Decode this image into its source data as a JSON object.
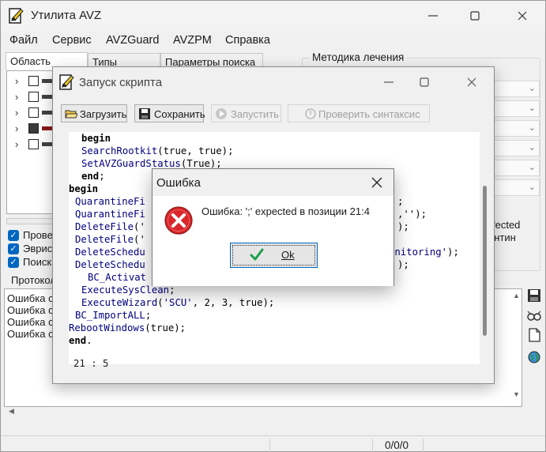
{
  "main": {
    "title": "Утилита AVZ",
    "menu": [
      "Файл",
      "Сервис",
      "AVZGuard",
      "AVZPM",
      "Справка"
    ],
    "tabs": [
      "Область поиска",
      "Типы файлов",
      "Параметры поиска"
    ],
    "checks": [
      "Прове",
      "Эвристи",
      "Поиск"
    ],
    "treatment_group_title": "Методика лечения",
    "right_partial_texts": [
      "fected",
      "антин"
    ],
    "protocol_label": "Протокол",
    "log_lines": [
      "Ошибка с",
      "Ошибка с",
      "Ошибка с",
      "Ошибка с"
    ],
    "status_counts": "0/0/0"
  },
  "script": {
    "title": "Запуск скрипта",
    "toolbar": {
      "load": "Загрузить",
      "save": "Сохранить",
      "run": "Запустить",
      "check": "Проверить синтаксис"
    },
    "cursor_pos": "21 : 5"
  },
  "error_dialog": {
    "title": "Ошибка",
    "message": "Ошибка: ';' expected в позиции 21:4",
    "ok_label": "Ok"
  },
  "colors": {
    "accent": "#0067c0",
    "error_red": "#d8262a",
    "ok_green": "#1aa04a"
  }
}
